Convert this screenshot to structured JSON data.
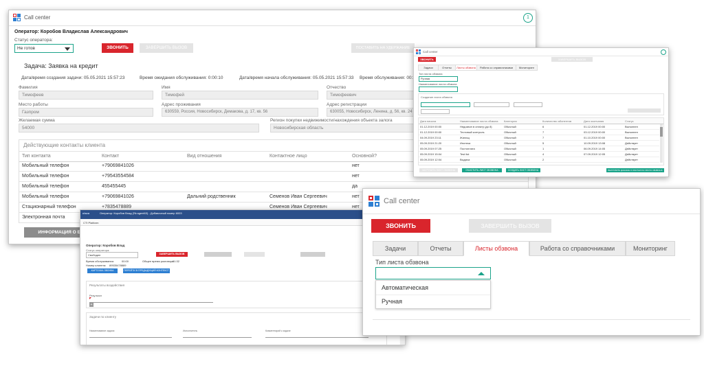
{
  "colors": {
    "red": "#d9252c",
    "teal": "#1aa389",
    "blue": "#2d7fd2",
    "gray": "#e4e4e4"
  },
  "main": {
    "title": "Call center",
    "operator": "Оператор: Коробов Владислав Александрович",
    "status_label": "Статус оператора:",
    "status_value": "Не готов",
    "call_button": "ЗВОНИТЬ",
    "end_call_button": "ЗАВЕРШИТЬ ВЫЗОВ",
    "hold_button": "ПОСТАВИТЬ НА УДЕРЖАНИЕ",
    "task_title": "Задача: Заявка на кредит",
    "created": "Дата/время создания задачи: 05.05.2021 15:57:23",
    "waiting": "Время ожидания обслуживания: 0:00:10",
    "started": "Дата/время начала обслуживания: 05.05.2021 15:57:33",
    "service_time": "Время обслуживания: 00:32",
    "fields": {
      "surname_label": "Фамилия",
      "surname": "Тимофеев",
      "name_label": "Имя",
      "name": "Тимофей",
      "patronymic_label": "Отчество",
      "patronymic": "Тимофеевич",
      "work_label": "Место работы",
      "work": "Газпром",
      "address_label": "Адрес проживания",
      "address": "630559, Россия, Новосибирск, Демакова, д. 17, кв. 56",
      "reg_label": "Адрес регистрации",
      "reg": "630055, Новосибирск, Ленина, д. 56, кв. 24",
      "sum_label": "Желаемая сумма",
      "sum": "54000",
      "region_label": "Регион покупки недвижимости/нахождения объекта залога",
      "region": "Новосибирская область"
    },
    "contacts_title": "Действующие контакты клиента",
    "contacts_headers": [
      "Тип контакта",
      "Контакт",
      "Вид отношения",
      "Контактное лицо",
      "Основной?"
    ],
    "contacts": [
      [
        "Мобильный телефон",
        "+79069841026",
        "",
        "",
        "нет"
      ],
      [
        "Мобильный телефон",
        "+79543554584",
        "",
        "",
        "нет"
      ],
      [
        "Мобильный телефон",
        "455455445",
        "",
        "",
        "да"
      ],
      [
        "Мобильный телефон",
        "+79069841026",
        "Дальний родственник",
        "Семенов Иван Сергеевич",
        "нет"
      ],
      [
        "Стационарный телефон",
        "+7835478889",
        "",
        "Семенов Иван Сергеевич",
        "нет"
      ],
      [
        "Электронная почта",
        "",
        "",
        "",
        ""
      ]
    ],
    "bank_info_button": "ИНФОРМАЦИЯ О БАНКЕ"
  },
  "top_right": {
    "title": "Call center",
    "call_button": "ЗВОНИТЬ",
    "end_call_button": "ЗАВЕРШИТЬ ВЫЗОВ",
    "tabs": [
      "Задачи",
      "Отчеты",
      "Листы обзвона",
      "Работа со справочниками",
      "Мониторинг"
    ],
    "list_type_label": "Тип листа обзвона",
    "list_type_value": "Ручная",
    "list_name_label": "Наименование листа обзвона",
    "section_label": "Создание листа обзвона",
    "table_headers": [
      "Дата начала",
      "Наименование листа обзвона",
      "Категория",
      "Количество абонентов",
      "Дата окончания",
      "Статус"
    ],
    "rows": [
      [
        "01.12.2019 00:00",
        "Недозвон в оплату (до 8)",
        "Обычный",
        "6",
        "01.12.2019 00:00",
        "Выполнен"
      ],
      [
        "01.12.2019 00:00",
        "Тестовый контроль",
        "Обычный",
        "7",
        "03.12.2019 00:00",
        "Выполнен"
      ],
      [
        "04.09.2019 23:11",
        "Жилищ",
        "Обычный",
        "7",
        "01.10.2019 00:00",
        "Выполнен"
      ],
      [
        "05.09.2019 21:20",
        "Ипотека",
        "Обычный",
        "5",
        "10.09.2019 13:08",
        "Действует"
      ],
      [
        "05.09.2019 07:25",
        "Постоплата",
        "Обычный",
        "1",
        "06.09.2019 14:05",
        "Действует"
      ],
      [
        "05.09.2019 15:04",
        "Test list",
        "Обычный",
        "4",
        "07.09.2019 12:05",
        "Действует"
      ],
      [
        "05.09.2019 12:04",
        "Выдача",
        "Обычный",
        "2",
        "",
        "Действует"
      ]
    ],
    "buttons": [
      "ЗАГРУЗИТЬ ЛИСТ ОБЗВОНА",
      "ОЧИСТИТЬ ЛИСТ ОБЗВОНА",
      "СОЗДАТЬ ЛИСТ ОБЗВОНА",
      "ВЫГРУЗИТЬ ДАННЫЕ О КОНТАКТАХ ЛИСТА ОБЗВОНА"
    ]
  },
  "bottom_left": {
    "titlebar": "Оператор: Коробов Влад (№ agent63) - Добавочный номер 6003",
    "platform": "CTI Platform",
    "operator": "Оператор: Коробов Влад",
    "status_label": "Статус оператора:",
    "status_value": "Свободен",
    "end_call_button": "ЗАВЕРШИТЬ ВЫЗОВ",
    "service_label": "Время обслуживания:",
    "service_time": "00:00",
    "total_label": "Общее время разговора:",
    "total_time": "01:32",
    "phone_label": "Номер клиента:",
    "phone": "89535478889",
    "blue_buttons": [
      "КАРТОЧКА ЗВОНКА",
      "ПЕРЕЙТИ В ПРЕДЫДУЩИЙ КОНТЕКСТ"
    ],
    "result_section": "Результаты воздействия",
    "result_label": "Результат",
    "task_section": "Задачи по клиенту",
    "col1": "Наименование задачи",
    "col2": "Исполнитель",
    "col3": "Комментарий к задаче"
  },
  "bottom_right": {
    "title": "Call center",
    "call_button": "ЗВОНИТЬ",
    "end_call_button": "ЗАВЕРШИТЬ ВЫЗОВ",
    "tabs": [
      "Задачи",
      "Отчеты",
      "Листы обзвона",
      "Работа со справочниками",
      "Мониторинг"
    ],
    "dropdown_label": "Тип листа обзвона",
    "options": [
      "Автоматическая",
      "Ручная"
    ]
  }
}
